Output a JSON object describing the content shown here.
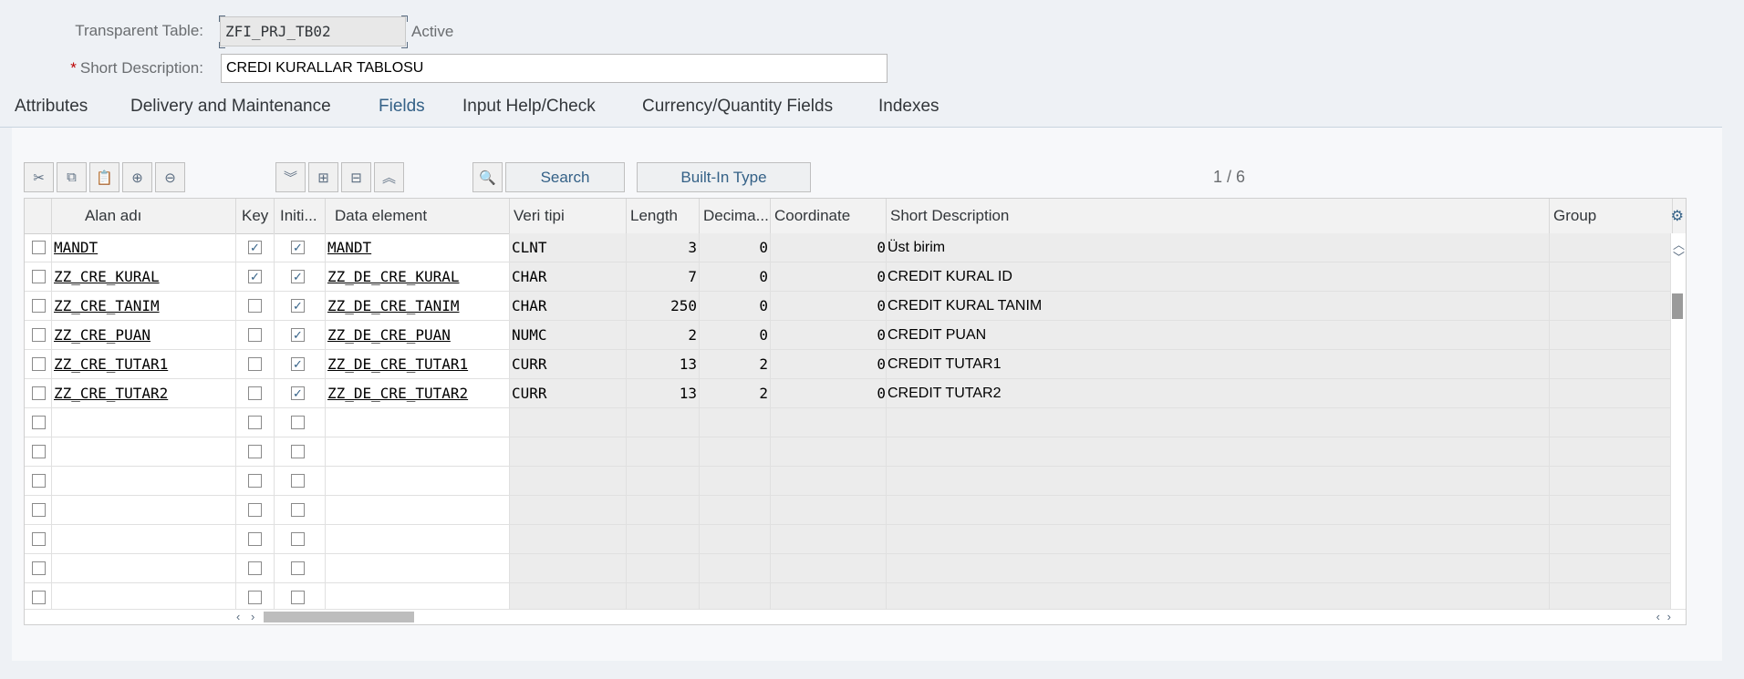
{
  "header": {
    "table_label": "Transparent Table:",
    "table_name": "ZFI_PRJ_TB02",
    "status": "Active",
    "desc_required": "*",
    "desc_label": "Short Description:",
    "desc_value": "CREDI KURALLAR TABLOSU"
  },
  "tabs": [
    "Attributes",
    "Delivery and Maintenance",
    "Fields",
    "Input Help/Check",
    "Currency/Quantity Fields",
    "Indexes"
  ],
  "active_tab": "Fields",
  "toolbar": {
    "icons": [
      "cut-icon",
      "copy-icon",
      "paste-icon",
      "add-row-icon",
      "remove-row-icon",
      "expand-all-icon",
      "insert-row-icon",
      "delete-row-icon",
      "collapse-all-icon",
      "search-key-icon"
    ],
    "search_label": "Search",
    "builtin_label": "Built-In Type",
    "pager": "1  /  6"
  },
  "grid": {
    "columns": [
      "Alan adı",
      "Key",
      "Initi...",
      "Data element",
      "Veri tipi",
      "Length",
      "Decima...",
      "Coordinate",
      "Short Description",
      "Group"
    ],
    "rows": [
      {
        "field": "MANDT",
        "key": true,
        "initial": true,
        "element": "MANDT",
        "type": "CLNT",
        "length": "3",
        "decimals": "0",
        "coordinate": "0",
        "desc": "Üst birim"
      },
      {
        "field": "ZZ_CRE_KURAL",
        "key": true,
        "initial": true,
        "element": "ZZ_DE_CRE_KURAL",
        "type": "CHAR",
        "length": "7",
        "decimals": "0",
        "coordinate": "0",
        "desc": "CREDIT KURAL ID"
      },
      {
        "field": "ZZ_CRE_TANIM",
        "key": false,
        "initial": true,
        "element": "ZZ_DE_CRE_TANIM",
        "type": "CHAR",
        "length": "250",
        "decimals": "0",
        "coordinate": "0",
        "desc": "CREDIT KURAL TANIM"
      },
      {
        "field": "ZZ_CRE_PUAN",
        "key": false,
        "initial": true,
        "element": "ZZ_DE_CRE_PUAN",
        "type": "NUMC",
        "length": "2",
        "decimals": "0",
        "coordinate": "0",
        "desc": "CREDIT PUAN"
      },
      {
        "field": "ZZ_CRE_TUTAR1",
        "key": false,
        "initial": true,
        "element": "ZZ_DE_CRE_TUTAR1",
        "type": "CURR",
        "length": "13",
        "decimals": "2",
        "coordinate": "0",
        "desc": "CREDIT TUTAR1"
      },
      {
        "field": "ZZ_CRE_TUTAR2",
        "key": false,
        "initial": true,
        "element": "ZZ_DE_CRE_TUTAR2",
        "type": "CURR",
        "length": "13",
        "decimals": "2",
        "coordinate": "0",
        "desc": "CREDIT TUTAR2"
      },
      {
        "field": "",
        "key": false,
        "initial": false,
        "element": "",
        "type": "",
        "length": "",
        "decimals": "",
        "coordinate": "",
        "desc": ""
      },
      {
        "field": "",
        "key": false,
        "initial": false,
        "element": "",
        "type": "",
        "length": "",
        "decimals": "",
        "coordinate": "",
        "desc": ""
      },
      {
        "field": "",
        "key": false,
        "initial": false,
        "element": "",
        "type": "",
        "length": "",
        "decimals": "",
        "coordinate": "",
        "desc": ""
      },
      {
        "field": "",
        "key": false,
        "initial": false,
        "element": "",
        "type": "",
        "length": "",
        "decimals": "",
        "coordinate": "",
        "desc": ""
      },
      {
        "field": "",
        "key": false,
        "initial": false,
        "element": "",
        "type": "",
        "length": "",
        "decimals": "",
        "coordinate": "",
        "desc": ""
      },
      {
        "field": "",
        "key": false,
        "initial": false,
        "element": "",
        "type": "",
        "length": "",
        "decimals": "",
        "coordinate": "",
        "desc": ""
      },
      {
        "field": "",
        "key": false,
        "initial": false,
        "element": "",
        "type": "",
        "length": "",
        "decimals": "",
        "coordinate": "",
        "desc": ""
      }
    ]
  },
  "colors": {
    "accent": "#346187",
    "required": "#bb0000",
    "readonly_cell": "#ececec"
  }
}
